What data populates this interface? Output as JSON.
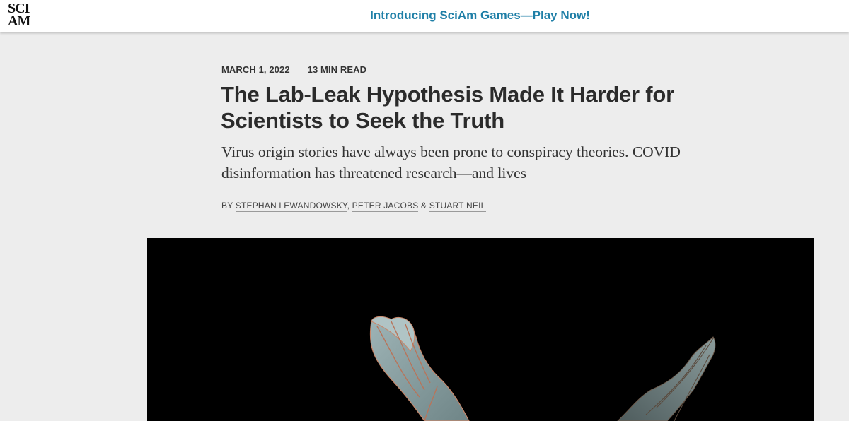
{
  "header": {
    "logo_line1": "SCI",
    "logo_line2": "AM",
    "promo_text": "Introducing SciAm Games—Play Now!",
    "promo_color": "#1f7fa7"
  },
  "article": {
    "date": "MARCH 1, 2022",
    "read_time": "13 MIN READ",
    "title": "The Lab-Leak Hypothesis Made It Harder for Scientists to Seek the Truth",
    "subtitle": "Virus origin stories have always been prone to conspiracy theories. COVID disinformation has threatened research—and lives",
    "byline_prefix": "BY",
    "authors": [
      "STEPHAN LEWANDOWSKY",
      "PETER JACOBS",
      "STUART NEIL"
    ],
    "author_sep_1": ", ",
    "author_sep_2": " & "
  },
  "hero_image": {
    "subject": "bat-in-flight",
    "background": "#000000"
  }
}
